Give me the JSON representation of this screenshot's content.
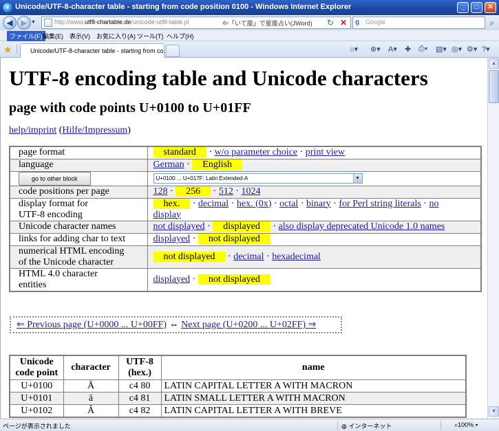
{
  "window": {
    "title": "Unicode/UTF-8-character table - starting from code position 0100 - Windows Internet Explorer",
    "buttons": {
      "minimize": "_",
      "maximize": "□",
      "close": "✕"
    }
  },
  "address": {
    "url_prefix": "http://www.",
    "url_domain": "utf8-chartable.de",
    "url_path": "/unicode-utf8-table.pl",
    "hint": "⇐「いて座」で星座占い(JWord)"
  },
  "search": {
    "placeholder": "Google"
  },
  "menu": {
    "file": "ファイル(F)",
    "edit": "編集(E)",
    "view": "表示(V)",
    "favorites": "お気に入り(A)",
    "tools": "ツール(T)",
    "help": "ヘルプ(H)"
  },
  "tab": {
    "label": "Unicode/UTF-8-character table - starting from co..."
  },
  "page": {
    "h1": "UTF-8 encoding table and Unicode characters",
    "h2": "page with code points U+0100 to U+01FF",
    "help_link": "help/imprint",
    "hilfe_link": "Hilfe/Impressum",
    "options": {
      "page_format": {
        "label": "page format",
        "selected": "standard",
        "opt2": "w/o parameter choice",
        "opt3": "print view"
      },
      "language": {
        "label": "language",
        "opt1": "German",
        "selected": "English"
      },
      "block": {
        "button": "go to other block",
        "select": "U+0100 ... U+017F: Latin Extended-A"
      },
      "code_positions": {
        "label": "code positions per page",
        "opt1": "128",
        "selected": "256",
        "opt3": "512",
        "opt4": "1024"
      },
      "display_format": {
        "label1": "display format for",
        "label2": "UTF-8 encoding",
        "selected": "hex.",
        "opt2": "decimal",
        "opt3": "hex. (0x)",
        "opt4": "octal",
        "opt5": "binary",
        "opt6": "for Perl string literals",
        "opt7a": "no",
        "opt7b": "display"
      },
      "char_names": {
        "label": "Unicode character names",
        "opt1": "not displayed",
        "selected": "displayed",
        "opt3": "also display deprecated Unicode 1.0 names"
      },
      "links": {
        "label": "links for adding char to text",
        "opt1": "displayed",
        "selected": "not displayed"
      },
      "numerical": {
        "label1": "numerical HTML encoding",
        "label2": "of the Unicode character",
        "selected": "not displayed",
        "opt2": "decimal",
        "opt3": "hexadecimal"
      },
      "html4": {
        "label1": "HTML 4.0 character",
        "label2": "entities",
        "opt1": "displayed",
        "selected": "not displayed"
      }
    },
    "pager": {
      "prev": "⇐ Previous page (U+0000 ... U+00FF)",
      "middle": "⇔",
      "next": "Next page (U+0200 ... U+02FF) ⇒"
    },
    "table": {
      "headers": {
        "code1": "Unicode",
        "code2": "code point",
        "char": "character",
        "utf1": "UTF-8",
        "utf2": "(hex.)",
        "name": "name"
      },
      "rows": [
        {
          "code": "U+0100",
          "char": "Ā",
          "utf": "c4 80",
          "name": "LATIN CAPITAL LETTER A WITH MACRON"
        },
        {
          "code": "U+0101",
          "char": "ā",
          "utf": "c4 81",
          "name": "LATIN SMALL LETTER A WITH MACRON"
        },
        {
          "code": "U+0102",
          "char": "Ă",
          "utf": "c4 82",
          "name": "LATIN CAPITAL LETTER A WITH BREVE"
        }
      ]
    }
  },
  "status": {
    "text": "ページが表示されました",
    "zone": "インターネット",
    "zoom": "100%"
  },
  "colors": {
    "highlight": "#ffff00",
    "link": "#1a1aa6",
    "titlebar": "#1d47a6"
  }
}
